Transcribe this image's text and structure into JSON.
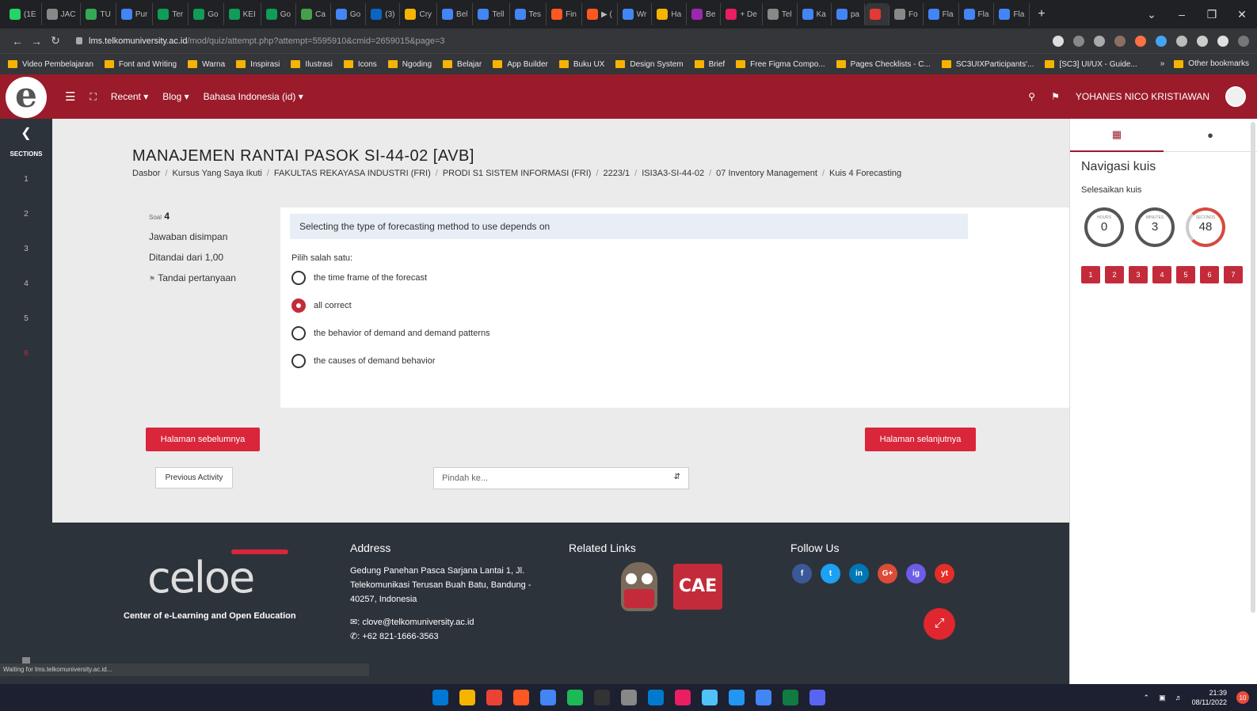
{
  "browser": {
    "tabs": [
      "(1E",
      "JAC",
      "TU",
      "Pur",
      "Ter",
      "Go",
      "KEI",
      "Go",
      "Ca",
      "Go",
      "(3)",
      "Cry",
      "Bel",
      "Tell",
      "Tes",
      "Fin",
      "▶ (",
      "Wr",
      "Ha",
      "Be",
      "+ De",
      "Tel",
      "Ka",
      "pa",
      "",
      "Fo",
      "Fla",
      "Fla",
      "Fla"
    ],
    "tab_colors": [
      "#25d366",
      "#888",
      "#34a853",
      "#4285f4",
      "#0f9d58",
      "#0f9d58",
      "#0f9d58",
      "#0f9d58",
      "#46a049",
      "#4285f4",
      "#0a66c2",
      "#f4b400",
      "#4285f4",
      "#4285f4",
      "#4285f4",
      "#ff5722",
      "#ff5722",
      "#4285f4",
      "#f4b400",
      "#9c27b0",
      "#e91e63",
      "#888",
      "#4285f4",
      "#4285f4",
      "#e53935",
      "#888",
      "#4285f4",
      "#4285f4",
      "#4285f4"
    ],
    "url_domain": "lms.telkomuniversity.ac.id",
    "url_path": "/mod/quiz/attempt.php?attempt=5595910&cmid=2659015&page=3",
    "bookmarks": [
      "Video Pembelajaran",
      "Font and Writing",
      "Warna",
      "Inspirasi",
      "Ilustrasi",
      "Icons",
      "Ngoding",
      "Belajar",
      "App Builder",
      "Buku UX",
      "Design System",
      "Brief",
      "Free Figma Compo...",
      "Pages Checklists - C...",
      "SC3UIXParticipants'...",
      "[SC3] UI/UX - Guide..."
    ],
    "other_bookmarks": "Other bookmarks",
    "status_text": "Waiting for lms.telkomuniversity.ac.id..."
  },
  "topnav": {
    "items": [
      "Recent ▾",
      "Blog ▾",
      "Bahasa Indonesia (id) ▾"
    ],
    "user": "YOHANES NICO KRISTIAWAN"
  },
  "sidebar": {
    "title": "SECTIONS",
    "sections": [
      "1",
      "2",
      "3",
      "4",
      "5",
      "6"
    ]
  },
  "course": {
    "title": "MANAJEMEN RANTAI PASOK SI-44-02 [AVB]",
    "breadcrumb": [
      "Dasbor",
      "Kursus Yang Saya Ikuti",
      "FAKULTAS REKAYASA INDUSTRI (FRI)",
      "PRODI S1 SISTEM INFORMASI (FRI)",
      "2223/1",
      "ISI3A3-SI-44-02",
      "07 Inventory Management",
      "Kuis 4 Forecasting"
    ]
  },
  "question": {
    "label": "Soal",
    "number": "4",
    "status": "Jawaban disimpan",
    "marks": "Ditandai dari 1,00",
    "flag": "Tandai pertanyaan",
    "text": "Selecting the type of forecasting method to use depends on",
    "prompt": "Pilih salah satu:",
    "options": [
      "the time frame of the forecast",
      "all correct",
      "the behavior of demand and demand patterns",
      "the causes of demand behavior"
    ],
    "selected_index": 1
  },
  "buttons": {
    "prev_page": "Halaman sebelumnya",
    "next_page": "Halaman selanjutnya",
    "prev_activity": "Previous Activity",
    "jump_placeholder": "Pindah ke..."
  },
  "quiz_nav": {
    "title": "Navigasi kuis",
    "finish": "Selesaikan kuis",
    "timers": [
      {
        "label": "HOURS",
        "value": "0"
      },
      {
        "label": "MINUTES",
        "value": "3"
      },
      {
        "label": "SECONDS",
        "value": "48"
      }
    ],
    "questions": [
      "1",
      "2",
      "3",
      "4",
      "5",
      "6",
      "7"
    ]
  },
  "footer": {
    "logo_text": "celoe",
    "logo_sub": "Center of e-Learning and Open Education",
    "address_title": "Address",
    "address": "Gedung Panehan Pasca Sarjana Lantai 1, Jl. Telekomunikasi Terusan Buah Batu, Bandung - 40257, Indonesia",
    "email": ": clove@telkomuniversity.ac.id",
    "phone": ": +62 821-1666-3563",
    "related_title": "Related Links",
    "cae_text": "CAE",
    "follow_title": "Follow Us",
    "social_icons": [
      "f",
      "t",
      "in",
      "G+",
      "ig",
      "yt"
    ],
    "social_colors": [
      "#3b5998",
      "#1da1f2",
      "#0077b5",
      "#dd4b39",
      "#6c5ce7",
      "#e52d27"
    ]
  },
  "taskbar": {
    "time": "21:39",
    "date": "08/11/2022",
    "notif_count": "10",
    "icon_colors": [
      "#0078d4",
      "#f4b400",
      "#ea4335",
      "#ff5722",
      "#4285f4",
      "#1db954",
      "#333",
      "#888",
      "#007acc",
      "#e91e63",
      "#4fc3f7",
      "#2196f3",
      "#4285f4",
      "#107c41",
      "#5865f2"
    ]
  }
}
